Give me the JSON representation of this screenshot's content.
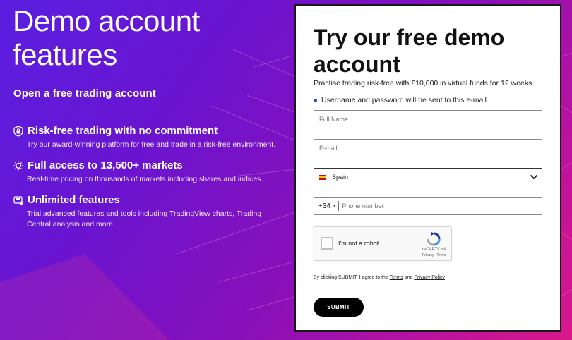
{
  "hero": {
    "title": "Demo account features",
    "subtitle": "Open a free trading account"
  },
  "features": [
    {
      "icon": "shield-lock-icon",
      "title": "Risk-free trading with no commitment",
      "description": "Try our award-winning platform for free and trade in a risk-free environment."
    },
    {
      "icon": "globe-markets-icon",
      "title": "Full access to 13,500+ markets",
      "description": "Real-time pricing on thousands of markets including shares and indices."
    },
    {
      "icon": "tools-icon",
      "title": "Unlimited features",
      "description": "Trial advanced features and tools including TradingView charts, Trading Central analysis and more."
    }
  ],
  "form": {
    "title": "Try our free demo account",
    "subtitle": "Practise trading risk-free with £10,000 in virtual funds for 12 weeks.",
    "note": "Username and password will be sent to this e-mail",
    "fullname_placeholder": "Full Name",
    "email_placeholder": "E-mail",
    "country_value": "Spain",
    "phone_code": "+34",
    "phone_placeholder": "Phone number",
    "captcha": {
      "label": "I'm not a robot",
      "brand": "reCAPTCHA",
      "links": "Privacy - Terms"
    },
    "legal": {
      "prefix": "By clicking SUBMIT, I agree to the",
      "terms": "Terms",
      "and": "and",
      "privacy": "Privacy Policy"
    },
    "submit_label": "SUBMIT"
  },
  "colors": {
    "accent_dot": "#1f4fa8",
    "submit_bg": "#000000",
    "flag_red": "#c60b1e",
    "flag_yellow": "#ffc400"
  }
}
